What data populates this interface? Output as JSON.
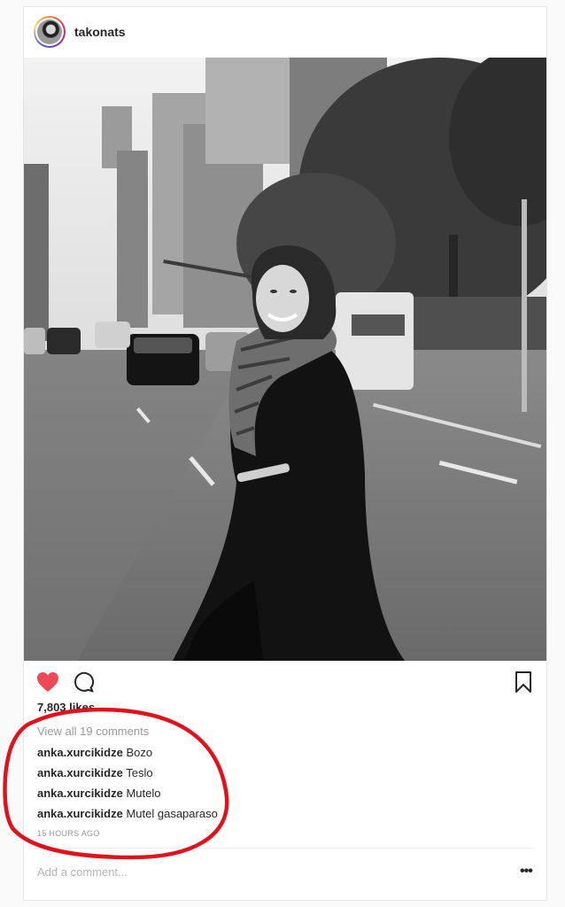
{
  "post": {
    "username": "takonats",
    "likes": "7,803 likes",
    "view_all_comments": "View all 19 comments",
    "comments": [
      {
        "user": "anka.xurcikidze",
        "text": "Bozo"
      },
      {
        "user": "anka.xurcikidze",
        "text": "Teslo"
      },
      {
        "user": "anka.xurcikidze",
        "text": "Mutelo"
      },
      {
        "user": "anka.xurcikidze",
        "text": "Mutel gasaparaso"
      }
    ],
    "timestamp": "15 HOURS AGO",
    "add_comment_placeholder": "Add a comment...",
    "liked": true
  },
  "icons": {
    "like": "heart-icon",
    "comment": "comment-icon",
    "save": "bookmark-icon",
    "more": "more-options-icon"
  },
  "colors": {
    "heart": "#ed4956",
    "annotation": "#e0131b"
  }
}
